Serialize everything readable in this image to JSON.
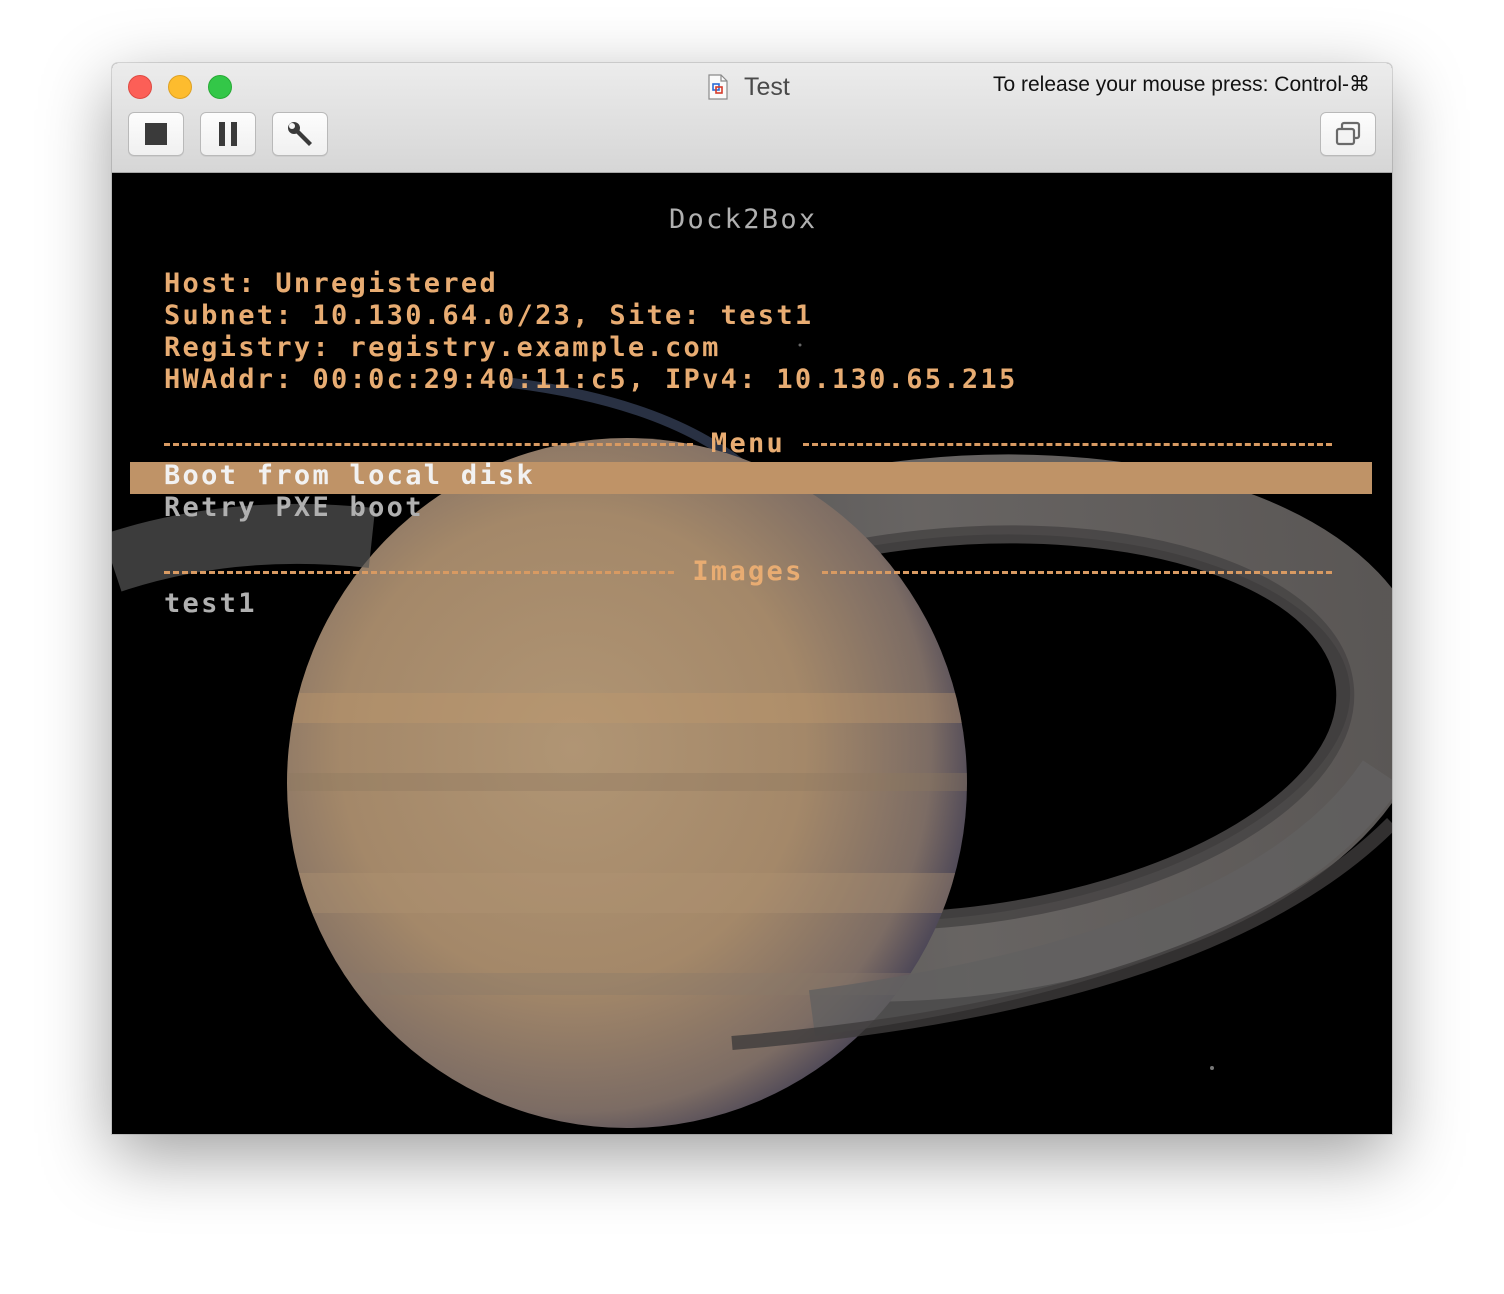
{
  "window": {
    "title": "Test",
    "release_hint": "To release your mouse press: Control-⌘"
  },
  "toolbar": {
    "buttons": [
      {
        "name": "stop",
        "icon": "stop-icon"
      },
      {
        "name": "pause",
        "icon": "pause-icon"
      },
      {
        "name": "settings",
        "icon": "wrench-icon"
      },
      {
        "name": "unity",
        "icon": "unity-windows-icon"
      }
    ]
  },
  "console": {
    "heading": "Dock2Box",
    "info": {
      "host": "Host: Unregistered",
      "subnet": "Subnet: 10.130.64.0/23, Site: test1",
      "registry": "Registry: registry.example.com",
      "hwaddr": "HWAddr: 00:0c:29:40:11:c5, IPv4: 10.130.65.215"
    },
    "menu": {
      "label": "Menu",
      "items": [
        {
          "label": "Boot from local disk",
          "selected": true
        },
        {
          "label": "Retry PXE boot",
          "selected": false
        }
      ]
    },
    "images": {
      "label": "Images",
      "items": [
        "test1"
      ]
    }
  },
  "colors": {
    "text_orange": "#e8ac72",
    "highlight": "#bf9367",
    "text_gray": "#b0b0b0"
  }
}
